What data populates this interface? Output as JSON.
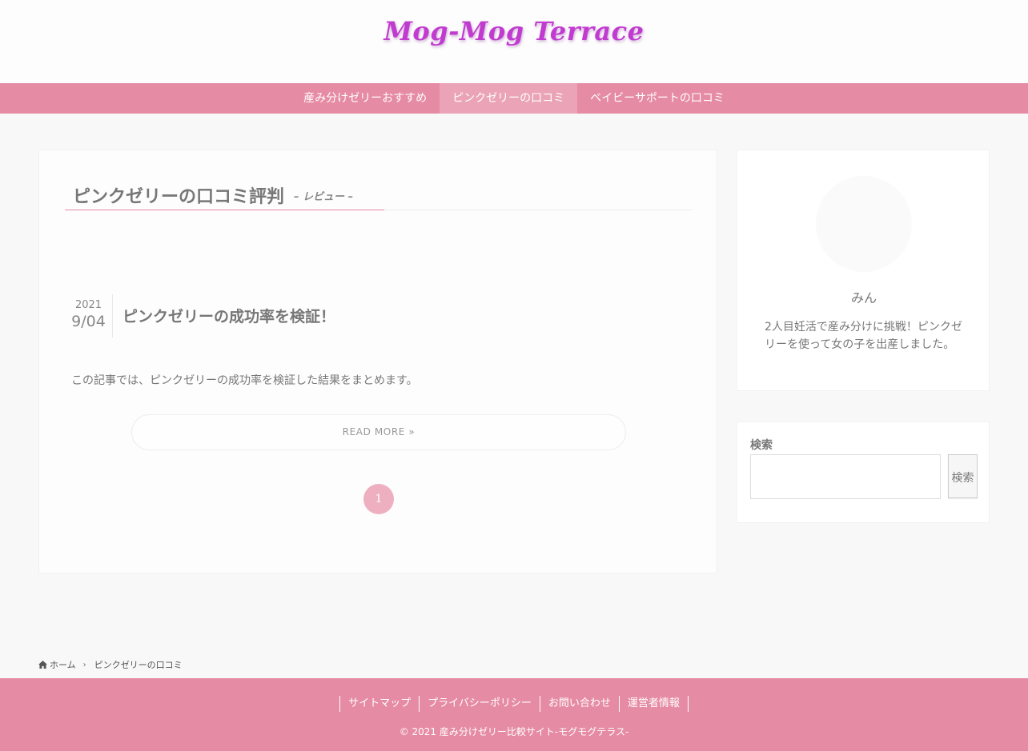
{
  "header": {
    "logo_text": "Mog-Mog Terrace"
  },
  "nav": {
    "items": [
      {
        "label": "産み分けゼリーおすすめ"
      },
      {
        "label": "ピンクゼリーの口コミ"
      },
      {
        "label": "ベイビーサポートの口コミ"
      }
    ],
    "active_index": 1
  },
  "archive": {
    "title": "ピンクゼリーの口コミ評判",
    "subtitle": "– レビュー –"
  },
  "post": {
    "year": "2021",
    "month_day": "9/04",
    "title": "ピンクゼリーの成功率を検証！",
    "excerpt": "この記事では、ピンクゼリーの成功率を検証した結果をまとめます。",
    "read_more": "READ MORE »"
  },
  "pagination": {
    "current": "1"
  },
  "profile": {
    "name": "みん",
    "description": "2人目妊活で産み分けに挑戦！ピンクゼリーを使って女の子を出産しました。"
  },
  "search": {
    "label": "検索",
    "input_value": "",
    "button_label": "検索"
  },
  "breadcrumb": {
    "home": "ホーム",
    "current": "ピンクゼリーの口コミ"
  },
  "footer": {
    "links": [
      "サイトマップ",
      "プライバシーポリシー",
      "お問い合わせ",
      "運営者情報"
    ],
    "copyright": "© 2021 産み分けゼリー比較サイト-モグモグテラス-"
  },
  "colors": {
    "accent": "#e68ba4",
    "logo": "#c13bd0",
    "pager": "#eeb0c0"
  },
  "icons": {
    "breadcrumb_home": "home-icon",
    "breadcrumb_separator": "chevron-right-icon"
  }
}
